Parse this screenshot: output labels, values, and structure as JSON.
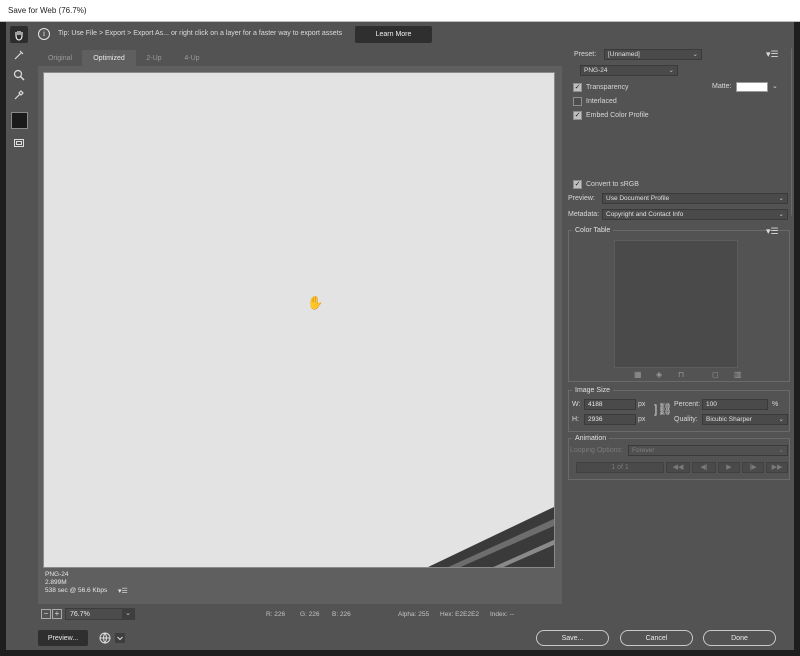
{
  "window": {
    "title": "Save for Web (76.7%)"
  },
  "tip": {
    "text": "Tip: Use File > Export > Export As...  or right click on a layer for a faster way to export assets",
    "learn_more": "Learn More"
  },
  "tabs": [
    "Original",
    "Optimized",
    "2-Up",
    "4-Up"
  ],
  "canvas_info": {
    "format": "PNG-24",
    "size": "2.899M",
    "time": "538 sec @ 56.6 Kbps",
    "menu": "▾☰"
  },
  "status": {
    "zoom": "76.7%",
    "r": "R: 226",
    "g": "G: 226",
    "b": "B: 226",
    "alpha": "Alpha: 255",
    "hex": "Hex: E2E2E2",
    "index": "Index: --"
  },
  "buttons": {
    "preview": "Preview...",
    "save": "Save...",
    "cancel": "Cancel",
    "done": "Done"
  },
  "settings": {
    "preset_label": "Preset:",
    "preset_value": "[Unnamed]",
    "format": "PNG-24",
    "transparency": "Transparency",
    "matte_label": "Matte:",
    "interlaced": "Interlaced",
    "embed_profile": "Embed Color Profile",
    "convert_srgb": "Convert to sRGB",
    "preview_label": "Preview:",
    "preview_value": "Use Document Profile",
    "metadata_label": "Metadata:",
    "metadata_value": "Copyright and Contact Info",
    "color_table": "Color Table",
    "matte_color": "#ffffff",
    "checked": {
      "transparency": true,
      "interlaced": false,
      "embed_profile": true,
      "convert_srgb": true
    }
  },
  "image_size": {
    "title": "Image Size",
    "w_label": "W:",
    "w_value": "4188",
    "h_label": "H:",
    "h_value": "2936",
    "unit": "px",
    "percent_label": "Percent:",
    "percent_value": "100",
    "percent_unit": "%",
    "quality_label": "Quality:",
    "quality_value": "Bicubic Sharper"
  },
  "animation": {
    "title": "Animation",
    "looping_label": "Looping Options:",
    "looping_value": "Forever",
    "frame": "1 of 1"
  }
}
